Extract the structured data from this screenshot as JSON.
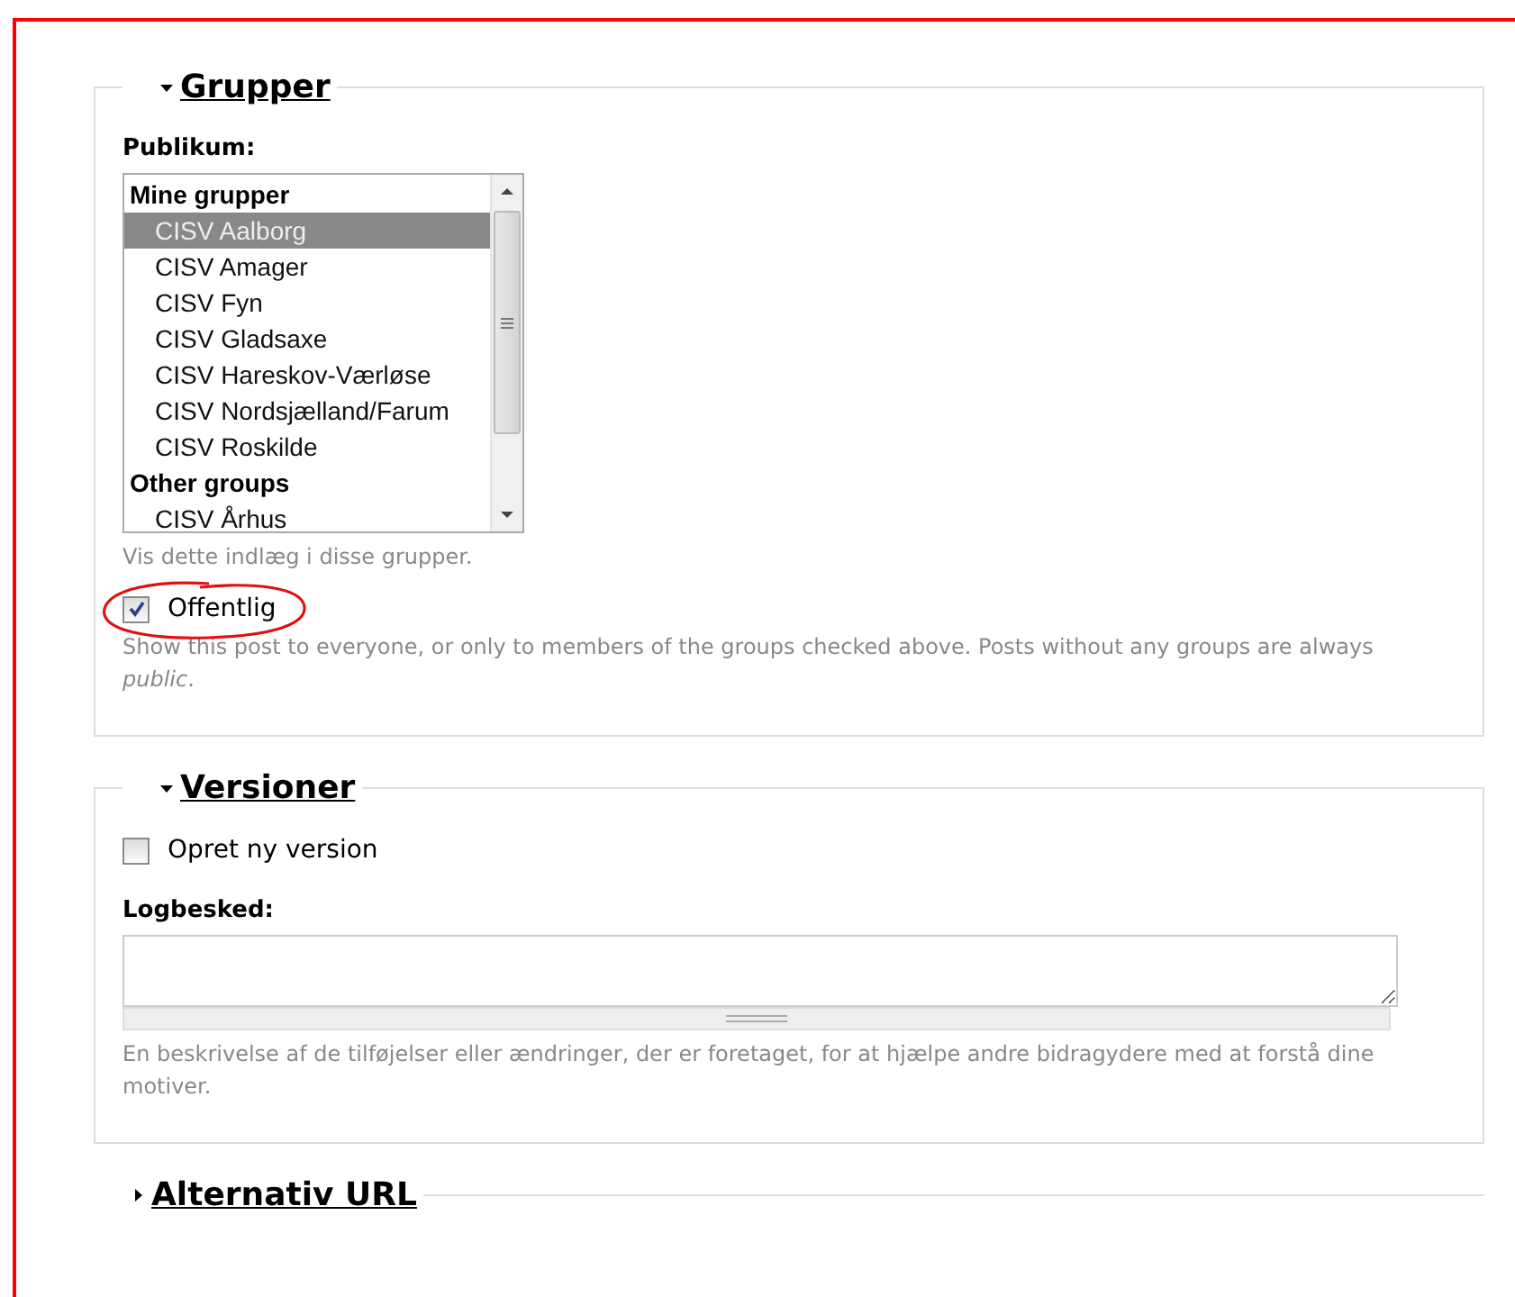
{
  "sections": [
    {
      "title": "Grupper",
      "expanded": true,
      "fields": [
        {
          "kind": "listbox",
          "label": "Publikum:",
          "groups": [
            {
              "label": "Mine grupper",
              "options": [
                {
                  "label": "CISV Aalborg",
                  "selected": true
                },
                {
                  "label": "CISV Amager",
                  "selected": false
                },
                {
                  "label": "CISV Fyn",
                  "selected": false
                },
                {
                  "label": "CISV Gladsaxe",
                  "selected": false
                },
                {
                  "label": "CISV Hareskov-Værløse",
                  "selected": false
                },
                {
                  "label": "CISV Nordsjælland/Farum",
                  "selected": false
                },
                {
                  "label": "CISV Roskilde",
                  "selected": false
                }
              ]
            },
            {
              "label": "Other groups",
              "options": [
                {
                  "label": "CISV Århus",
                  "selected": false
                }
              ]
            }
          ],
          "description": "Vis dette indlæg i disse grupper."
        },
        {
          "kind": "checkbox",
          "label": "Offentlig",
          "checked": true,
          "circled": true,
          "description": "Show this post to everyone, or only to members of the groups checked above. Posts without any groups are always *public*."
        }
      ]
    },
    {
      "title": "Versioner",
      "expanded": true,
      "fields": [
        {
          "kind": "checkbox",
          "label": "Opret ny version",
          "checked": false,
          "circled": false
        },
        {
          "kind": "textarea",
          "label": "Logbesked:",
          "description": "En beskrivelse af de tilføjelser eller ændringer, der er foretaget, for at hjælpe andre bidragydere med at forstå dine motiver."
        }
      ]
    },
    {
      "title": "Alternativ URL",
      "expanded": false
    }
  ]
}
